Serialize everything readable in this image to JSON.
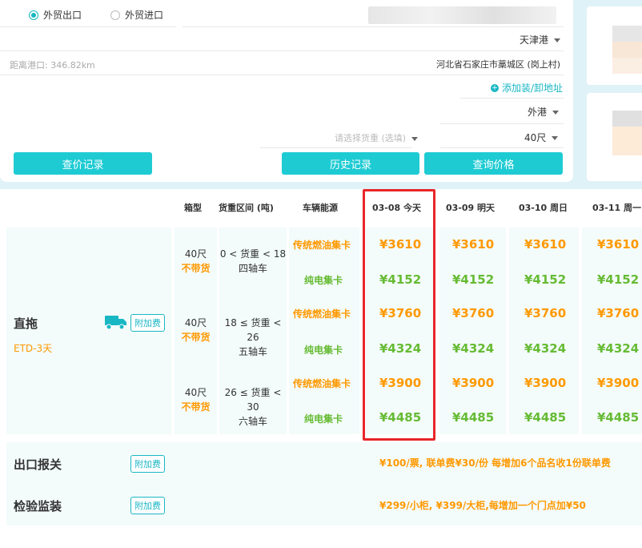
{
  "form": {
    "radio_export": "外贸出口",
    "radio_import": "外贸进口",
    "port": "天津港",
    "distance_label": "距离港口: 346.82km",
    "address": "河北省石家庄市藁城区 (岗上村)",
    "add_address": "添加装/卸地址",
    "terminal": "外港",
    "cargo_weight_placeholder": "请选择货重 (选填)",
    "container_size": "40尺"
  },
  "buttons": {
    "query_records": "查价记录",
    "history": "历史记录",
    "query_price": "查询价格"
  },
  "table": {
    "headers": {
      "box": "箱型",
      "weight": "货重区间 (吨)",
      "energy": "车辆能源",
      "days": [
        "03-08 今天",
        "03-09 明天",
        "03-10 周日",
        "03-11 周一"
      ]
    },
    "service": "直拖",
    "etd": "ETD-3天",
    "surcharge": "附加费",
    "groups": [
      {
        "box": "40尺",
        "no_goods": "不带货",
        "weight": "0 < 货重 < 18",
        "axle": "四轴车"
      },
      {
        "box": "40尺",
        "no_goods": "不带货",
        "weight": "18 ≤ 货重 < 26",
        "axle": "五轴车"
      },
      {
        "box": "40尺",
        "no_goods": "不带货",
        "weight": "26 ≤ 货重 < 30",
        "axle": "六轴车"
      }
    ],
    "rows": [
      {
        "energy": "传统燃油集卡",
        "type": "fuel",
        "prices": [
          "¥3610",
          "¥3610",
          "¥3610",
          "¥3610"
        ]
      },
      {
        "energy": "纯电集卡",
        "type": "elec",
        "prices": [
          "¥4152",
          "¥4152",
          "¥4152",
          "¥4152"
        ]
      },
      {
        "energy": "传统燃油集卡",
        "type": "fuel",
        "prices": [
          "¥3760",
          "¥3760",
          "¥3760",
          "¥3760"
        ]
      },
      {
        "energy": "纯电集卡",
        "type": "elec",
        "prices": [
          "¥4324",
          "¥4324",
          "¥4324",
          "¥4324"
        ]
      },
      {
        "energy": "传统燃油集卡",
        "type": "fuel",
        "prices": [
          "¥3900",
          "¥3900",
          "¥3900",
          "¥3900"
        ]
      },
      {
        "energy": "纯电集卡",
        "type": "elec",
        "prices": [
          "¥4485",
          "¥4485",
          "¥4485",
          "¥4485"
        ]
      }
    ]
  },
  "services": [
    {
      "title": "出口报关",
      "tag": "附加费",
      "text": "¥100/票, 联单费¥30/份  每增加6个品名收1份联单费"
    },
    {
      "title": "检验监装",
      "tag": "附加费",
      "text": "¥299/小柜, ¥399/大柜,每增加一个门点加¥50"
    }
  ],
  "colors": {
    "accent": "#1ecbd3",
    "orange": "#ff9900",
    "green": "#66bb33",
    "highlight": "#e8262a"
  }
}
